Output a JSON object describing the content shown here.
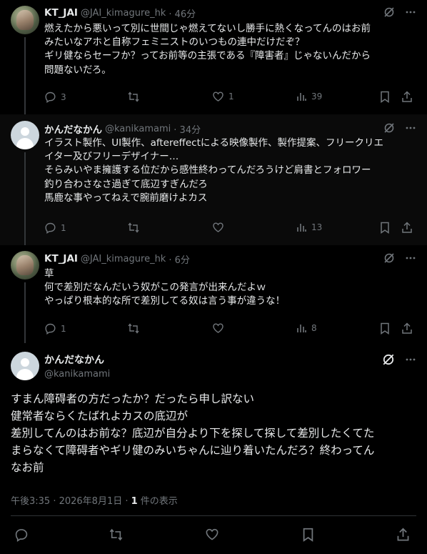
{
  "tweets": [
    {
      "name": "KT_JAI",
      "handle": "@JAI_kimagure_hk",
      "time": "· 46分",
      "avatar": "anime-figure-avatar",
      "text": "燃えたから悪いって別に世間じゃ燃えてないし勝手に熱くなってんのはお前\nみたいなアホと自称フェミニストのいつもの連中だけだぞ？\nギリ健ならセーフか？ってお前等の主張である『障害者』じゃないんだから\n問題ないだろ。",
      "replies": "3",
      "retweets": "",
      "likes": "1",
      "views": "39"
    },
    {
      "name": "かんだなかん",
      "handle": "@kanikamami",
      "time": "· 34分",
      "avatar": "default-avatar",
      "text": "イラスト製作、UI製作、aftereffectによる映像製作、製作提案、フリークリエ\nイター及びフリーデザイナー…\nそらみいやま擁護する位だから感性終わってんだろうけど肩書とフォロワー\n釣り合わさなさ過ぎて底辺すぎんだろ\n馬鹿な事やってねえで腕前磨けよカス",
      "replies": "1",
      "retweets": "",
      "likes": "",
      "views": "13"
    },
    {
      "name": "KT_JAI",
      "handle": "@JAI_kimagure_hk",
      "time": "· 6分",
      "avatar": "anime-figure-avatar",
      "text": "草\n何で差別だなんだいう奴がこの発言が出来んだよｗ\nやっぱり根本的な所で差別してる奴は言う事が違うな！",
      "replies": "1",
      "retweets": "",
      "likes": "",
      "views": "8"
    }
  ],
  "focus": {
    "name": "かんだなかん",
    "handle": "@kanikamami",
    "avatar": "default-avatar",
    "text": "すまん障碍者の方だったか？だったら申し訳ない\n健常者ならくたばれよカスの底辺が\n差別してんのはお前な？底辺が自分より下を探して探して差別したくてた\nまらなくて障碍者やギリ健のみいちゃんに辿り着いたんだろ？終わってん\nなお前",
    "timestamp": "午後3:35 · 2026年8月1日 · ",
    "views_count": "1",
    "views_label": " 件の表示"
  },
  "icons": {
    "grok": "grok-icon",
    "more": "more-icon",
    "reply": "reply-icon",
    "retweet": "retweet-icon",
    "like": "like-icon",
    "views": "views-icon",
    "bookmark": "bookmark-icon",
    "share": "share-icon"
  },
  "colors": {
    "background": "#000000",
    "text": "#e7e9ea",
    "muted": "#71767b",
    "divider": "#2f3336"
  }
}
